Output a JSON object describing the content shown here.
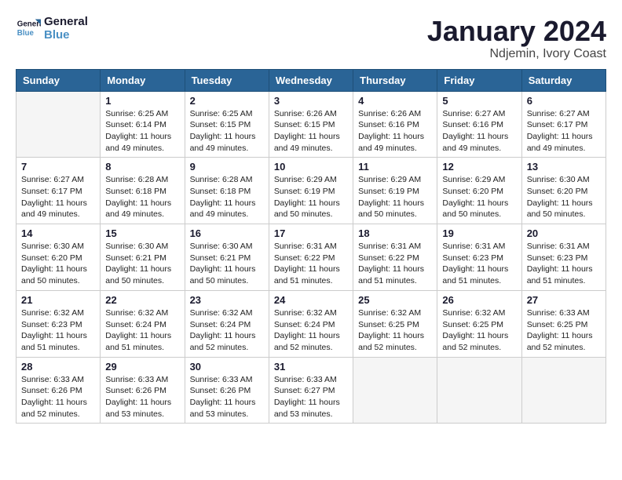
{
  "header": {
    "logo_line1": "General",
    "logo_line2": "Blue",
    "month": "January 2024",
    "location": "Ndjemin, Ivory Coast"
  },
  "weekdays": [
    "Sunday",
    "Monday",
    "Tuesday",
    "Wednesday",
    "Thursday",
    "Friday",
    "Saturday"
  ],
  "weeks": [
    [
      {
        "day": "",
        "info": ""
      },
      {
        "day": "1",
        "info": "Sunrise: 6:25 AM\nSunset: 6:14 PM\nDaylight: 11 hours\nand 49 minutes."
      },
      {
        "day": "2",
        "info": "Sunrise: 6:25 AM\nSunset: 6:15 PM\nDaylight: 11 hours\nand 49 minutes."
      },
      {
        "day": "3",
        "info": "Sunrise: 6:26 AM\nSunset: 6:15 PM\nDaylight: 11 hours\nand 49 minutes."
      },
      {
        "day": "4",
        "info": "Sunrise: 6:26 AM\nSunset: 6:16 PM\nDaylight: 11 hours\nand 49 minutes."
      },
      {
        "day": "5",
        "info": "Sunrise: 6:27 AM\nSunset: 6:16 PM\nDaylight: 11 hours\nand 49 minutes."
      },
      {
        "day": "6",
        "info": "Sunrise: 6:27 AM\nSunset: 6:17 PM\nDaylight: 11 hours\nand 49 minutes."
      }
    ],
    [
      {
        "day": "7",
        "info": "Sunrise: 6:27 AM\nSunset: 6:17 PM\nDaylight: 11 hours\nand 49 minutes."
      },
      {
        "day": "8",
        "info": "Sunrise: 6:28 AM\nSunset: 6:18 PM\nDaylight: 11 hours\nand 49 minutes."
      },
      {
        "day": "9",
        "info": "Sunrise: 6:28 AM\nSunset: 6:18 PM\nDaylight: 11 hours\nand 49 minutes."
      },
      {
        "day": "10",
        "info": "Sunrise: 6:29 AM\nSunset: 6:19 PM\nDaylight: 11 hours\nand 50 minutes."
      },
      {
        "day": "11",
        "info": "Sunrise: 6:29 AM\nSunset: 6:19 PM\nDaylight: 11 hours\nand 50 minutes."
      },
      {
        "day": "12",
        "info": "Sunrise: 6:29 AM\nSunset: 6:20 PM\nDaylight: 11 hours\nand 50 minutes."
      },
      {
        "day": "13",
        "info": "Sunrise: 6:30 AM\nSunset: 6:20 PM\nDaylight: 11 hours\nand 50 minutes."
      }
    ],
    [
      {
        "day": "14",
        "info": "Sunrise: 6:30 AM\nSunset: 6:20 PM\nDaylight: 11 hours\nand 50 minutes."
      },
      {
        "day": "15",
        "info": "Sunrise: 6:30 AM\nSunset: 6:21 PM\nDaylight: 11 hours\nand 50 minutes."
      },
      {
        "day": "16",
        "info": "Sunrise: 6:30 AM\nSunset: 6:21 PM\nDaylight: 11 hours\nand 50 minutes."
      },
      {
        "day": "17",
        "info": "Sunrise: 6:31 AM\nSunset: 6:22 PM\nDaylight: 11 hours\nand 51 minutes."
      },
      {
        "day": "18",
        "info": "Sunrise: 6:31 AM\nSunset: 6:22 PM\nDaylight: 11 hours\nand 51 minutes."
      },
      {
        "day": "19",
        "info": "Sunrise: 6:31 AM\nSunset: 6:23 PM\nDaylight: 11 hours\nand 51 minutes."
      },
      {
        "day": "20",
        "info": "Sunrise: 6:31 AM\nSunset: 6:23 PM\nDaylight: 11 hours\nand 51 minutes."
      }
    ],
    [
      {
        "day": "21",
        "info": "Sunrise: 6:32 AM\nSunset: 6:23 PM\nDaylight: 11 hours\nand 51 minutes."
      },
      {
        "day": "22",
        "info": "Sunrise: 6:32 AM\nSunset: 6:24 PM\nDaylight: 11 hours\nand 51 minutes."
      },
      {
        "day": "23",
        "info": "Sunrise: 6:32 AM\nSunset: 6:24 PM\nDaylight: 11 hours\nand 52 minutes."
      },
      {
        "day": "24",
        "info": "Sunrise: 6:32 AM\nSunset: 6:24 PM\nDaylight: 11 hours\nand 52 minutes."
      },
      {
        "day": "25",
        "info": "Sunrise: 6:32 AM\nSunset: 6:25 PM\nDaylight: 11 hours\nand 52 minutes."
      },
      {
        "day": "26",
        "info": "Sunrise: 6:32 AM\nSunset: 6:25 PM\nDaylight: 11 hours\nand 52 minutes."
      },
      {
        "day": "27",
        "info": "Sunrise: 6:33 AM\nSunset: 6:25 PM\nDaylight: 11 hours\nand 52 minutes."
      }
    ],
    [
      {
        "day": "28",
        "info": "Sunrise: 6:33 AM\nSunset: 6:26 PM\nDaylight: 11 hours\nand 52 minutes."
      },
      {
        "day": "29",
        "info": "Sunrise: 6:33 AM\nSunset: 6:26 PM\nDaylight: 11 hours\nand 53 minutes."
      },
      {
        "day": "30",
        "info": "Sunrise: 6:33 AM\nSunset: 6:26 PM\nDaylight: 11 hours\nand 53 minutes."
      },
      {
        "day": "31",
        "info": "Sunrise: 6:33 AM\nSunset: 6:27 PM\nDaylight: 11 hours\nand 53 minutes."
      },
      {
        "day": "",
        "info": ""
      },
      {
        "day": "",
        "info": ""
      },
      {
        "day": "",
        "info": ""
      }
    ]
  ]
}
